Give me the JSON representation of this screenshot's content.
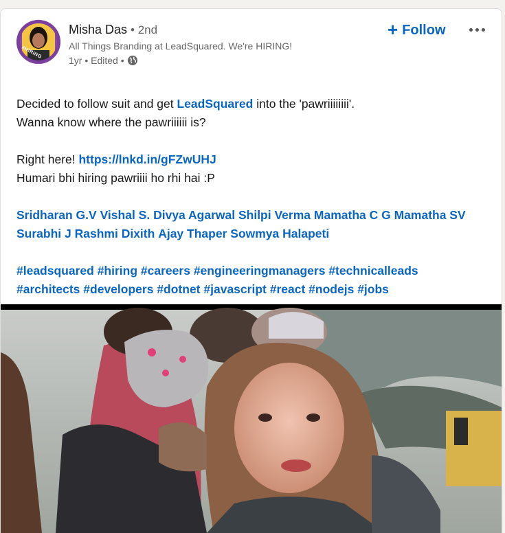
{
  "author": {
    "name": "Misha Das",
    "degree": "• 2nd",
    "headline": "All Things Branding at LeadSquared. We're HIRING!",
    "time": "1yr • Edited •",
    "avatar_badge": "#HIRING"
  },
  "actions": {
    "follow_label": "Follow",
    "follow_icon": "plus-icon",
    "more_icon": "more-options-icon"
  },
  "post": {
    "line1_pre": "Decided to follow suit and get ",
    "line1_link": "LeadSquared",
    "line1_post": " into the 'pawriiiiiiii'.",
    "line2": "Wanna know where the pawriiiiii is?",
    "line3_pre": "Right here! ",
    "line3_link": "https://lnkd.in/gFZwUHJ",
    "line4": "Humari bhi hiring pawriiii ho rhi hai :P",
    "mentions": [
      "Sridharan G.V",
      "Vishal S.",
      "Divya Agarwal",
      "Shilpi Verma",
      "Mamatha C G",
      "Mamatha SV",
      "Surabhi J",
      "Rashmi Dixith",
      "Ajay Thaper",
      "Sowmya Halapeti"
    ],
    "hashtags": [
      "#leadsquared",
      "#hiring",
      "#careers",
      "#engineeringmanagers",
      "#technicalleads",
      "#architects",
      "#developers",
      "#dotnet",
      "#javascript",
      "#react",
      "#nodejs",
      "#jobs"
    ]
  },
  "colors": {
    "link": "#0a66c2",
    "text": "#191919",
    "muted": "#666666"
  }
}
